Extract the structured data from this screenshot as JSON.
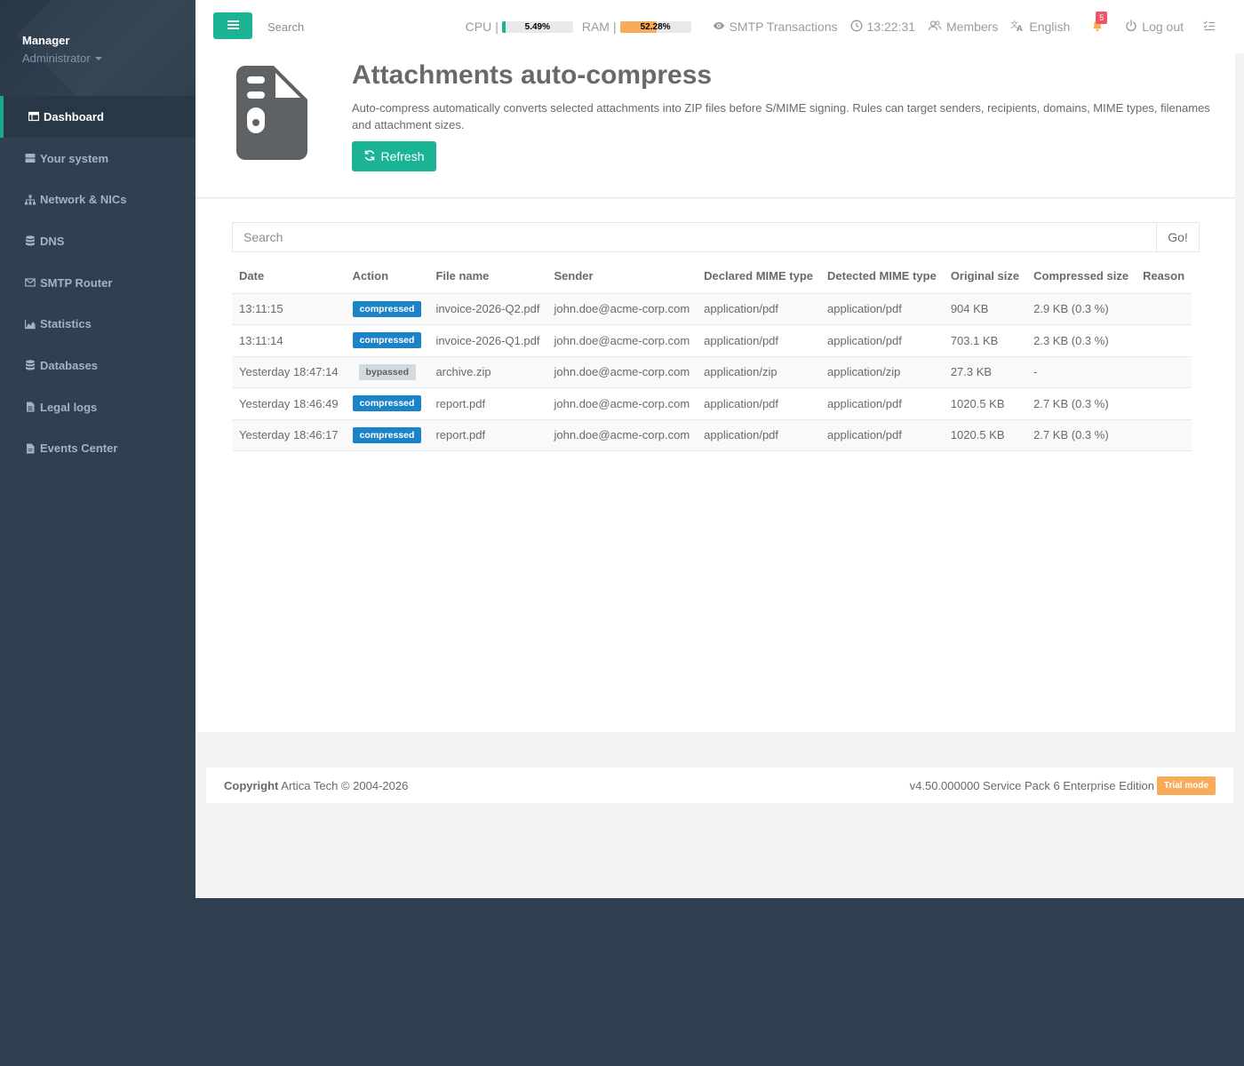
{
  "sidebar": {
    "user_name": "Manager",
    "user_role": "Administrator",
    "items": [
      {
        "label": "Dashboard",
        "icon": "table-icon",
        "active": true
      },
      {
        "label": "Your system",
        "icon": "server-icon"
      },
      {
        "label": "Network & NICs",
        "icon": "sitemap-icon"
      },
      {
        "label": "DNS",
        "icon": "database-icon"
      },
      {
        "label": "SMTP Router",
        "icon": "envelope-icon"
      },
      {
        "label": "Statistics",
        "icon": "area-chart-icon"
      },
      {
        "label": "Databases",
        "icon": "database-icon"
      },
      {
        "label": "Legal logs",
        "icon": "file-text-icon"
      },
      {
        "label": "Events Center",
        "icon": "file-icon"
      }
    ]
  },
  "topbar": {
    "search_placeholder": "Search",
    "cpu_label": "CPU",
    "cpu_value": "5.49%",
    "cpu_fraction": 0.0549,
    "ram_label": "RAM",
    "ram_value": "52.28%",
    "ram_fraction": 0.5228,
    "separator": "|",
    "smtp_label": "SMTP Transactions",
    "time": "13:22:31",
    "members_label": "Members",
    "language": "English",
    "notifications_count": "5",
    "logout_label": "Log out",
    "colors": {
      "accent": "#1ab394",
      "cpu_bar": "#1ab394",
      "ram_bar": "#f8ac59",
      "notify": "#ed5565"
    }
  },
  "header": {
    "title": "Attachments auto-compress",
    "description": "Auto-compress automatically converts selected attachments into ZIP files before S/MIME signing. Rules can target senders, recipients, domains, MIME types, filenames and attachment sizes.",
    "refresh_label": "Refresh"
  },
  "search": {
    "placeholder": "Search",
    "go_label": "Go!"
  },
  "table": {
    "columns": [
      "Date",
      "Action",
      "File name",
      "Sender",
      "Declared MIME type",
      "Detected MIME type",
      "Original size",
      "Compressed size",
      "Reason"
    ],
    "rows": [
      {
        "date": "13:11:15",
        "action": "compressed",
        "file": "invoice-2026-Q2.pdf",
        "sender": "john.doe@acme-corp.com",
        "declared": "application/pdf",
        "detected": "application/pdf",
        "original": "904 KB",
        "compressed": "2.9 KB (0.3 %)",
        "reason": ""
      },
      {
        "date": "13:11:14",
        "action": "compressed",
        "file": "invoice-2026-Q1.pdf",
        "sender": "john.doe@acme-corp.com",
        "declared": "application/pdf",
        "detected": "application/pdf",
        "original": "703.1 KB",
        "compressed": "2.3 KB (0.3 %)",
        "reason": ""
      },
      {
        "date": "Yesterday 18:47:14",
        "action": "bypassed",
        "file": "archive.zip",
        "sender": "john.doe@acme-corp.com",
        "declared": "application/zip",
        "detected": "application/zip",
        "original": "27.3 KB",
        "compressed": "-",
        "reason": ""
      },
      {
        "date": "Yesterday 18:46:49",
        "action": "compressed",
        "file": "report.pdf",
        "sender": "john.doe@acme-corp.com",
        "declared": "application/pdf",
        "detected": "application/pdf",
        "original": "1020.5 KB",
        "compressed": "2.7 KB (0.3 %)",
        "reason": ""
      },
      {
        "date": "Yesterday 18:46:17",
        "action": "compressed",
        "file": "report.pdf",
        "sender": "john.doe@acme-corp.com",
        "declared": "application/pdf",
        "detected": "application/pdf",
        "original": "1020.5 KB",
        "compressed": "2.7 KB (0.3 %)",
        "reason": ""
      }
    ]
  },
  "footer": {
    "copyright_label": "Copyright",
    "copyright_text": "Artica Tech © 2004-2026",
    "version": "v4.50.000000 Service Pack 6 Enterprise Edition",
    "trial_label": "Trial mode"
  }
}
